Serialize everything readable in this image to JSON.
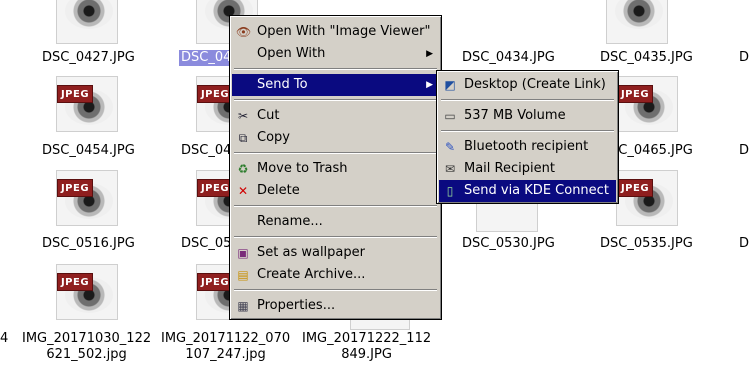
{
  "files": [
    {
      "label": "DSC_0427.JPG",
      "selected": false
    },
    {
      "label": "DSC_04",
      "selected": true
    },
    {
      "label": "DSC_0434.JPG",
      "selected": false
    },
    {
      "label": "DSC_0435.JPG",
      "selected": false
    },
    {
      "label": "DSC_0454.JPG",
      "selected": false
    },
    {
      "label": "DSC_04",
      "selected": false
    },
    {
      "label": "DSC_0465.JPG",
      "selected": false
    },
    {
      "label": "DSC_0516.JPG",
      "selected": false
    },
    {
      "label": "DSC_05",
      "selected": false
    },
    {
      "label": "DSC_0530.JPG",
      "selected": false
    },
    {
      "label": "DSC_0535.JPG",
      "selected": false
    },
    {
      "label": "IMG_20171030_122\n621_502.jpg",
      "selected": false
    },
    {
      "label": "IMG_20171122_070\n107_247.jpg",
      "selected": false
    },
    {
      "label": "IMG_20171222_112\n849.JPG",
      "selected": false
    },
    {
      "label": "D",
      "selected": false
    },
    {
      "label": "D",
      "selected": false
    },
    {
      "label": "D",
      "selected": false
    },
    {
      "label": "4",
      "selected": false
    }
  ],
  "thumb_badge": "JPEG",
  "context_menu": {
    "items": [
      {
        "label": "Open With \"Image Viewer\"",
        "icon": "image-viewer-eye-icon",
        "glyph": "👁"
      },
      {
        "label": "Open With",
        "icon": "",
        "glyph": "",
        "submenu": true
      },
      {
        "label": "Send To",
        "icon": "",
        "glyph": "",
        "submenu": true,
        "highlighted": true
      },
      {
        "label": "Cut",
        "icon": "scissors-icon",
        "glyph": "✂"
      },
      {
        "label": "Copy",
        "icon": "copy-icon",
        "glyph": "⧉"
      },
      {
        "label": "Move to Trash",
        "icon": "trash-icon",
        "glyph": "♻"
      },
      {
        "label": "Delete",
        "icon": "delete-x-icon",
        "glyph": "✕"
      },
      {
        "label": "Rename...",
        "icon": "",
        "glyph": ""
      },
      {
        "label": "Set as wallpaper",
        "icon": "wallpaper-icon",
        "glyph": "▣"
      },
      {
        "label": "Create Archive...",
        "icon": "archive-icon",
        "glyph": "▤"
      },
      {
        "label": "Properties...",
        "icon": "properties-icon",
        "glyph": "▦"
      }
    ]
  },
  "send_to_menu": {
    "items": [
      {
        "label": "Desktop (Create Link)",
        "icon": "desktop-link-icon",
        "glyph": "◩"
      },
      {
        "label": "537 MB Volume",
        "icon": "drive-icon",
        "glyph": "▭"
      },
      {
        "label": "Bluetooth recipient",
        "icon": "bluetooth-icon",
        "glyph": "✎"
      },
      {
        "label": "Mail Recipient",
        "icon": "mail-icon",
        "glyph": "✉"
      },
      {
        "label": "Send via KDE Connect",
        "icon": "phone-icon",
        "glyph": "▯",
        "highlighted": true
      }
    ]
  },
  "colors": {
    "highlight": "#0a0a80",
    "menu_bg": "#d4d0c8",
    "selection": "#8b8bdd",
    "jpeg_badge": "#8f1f1f"
  }
}
